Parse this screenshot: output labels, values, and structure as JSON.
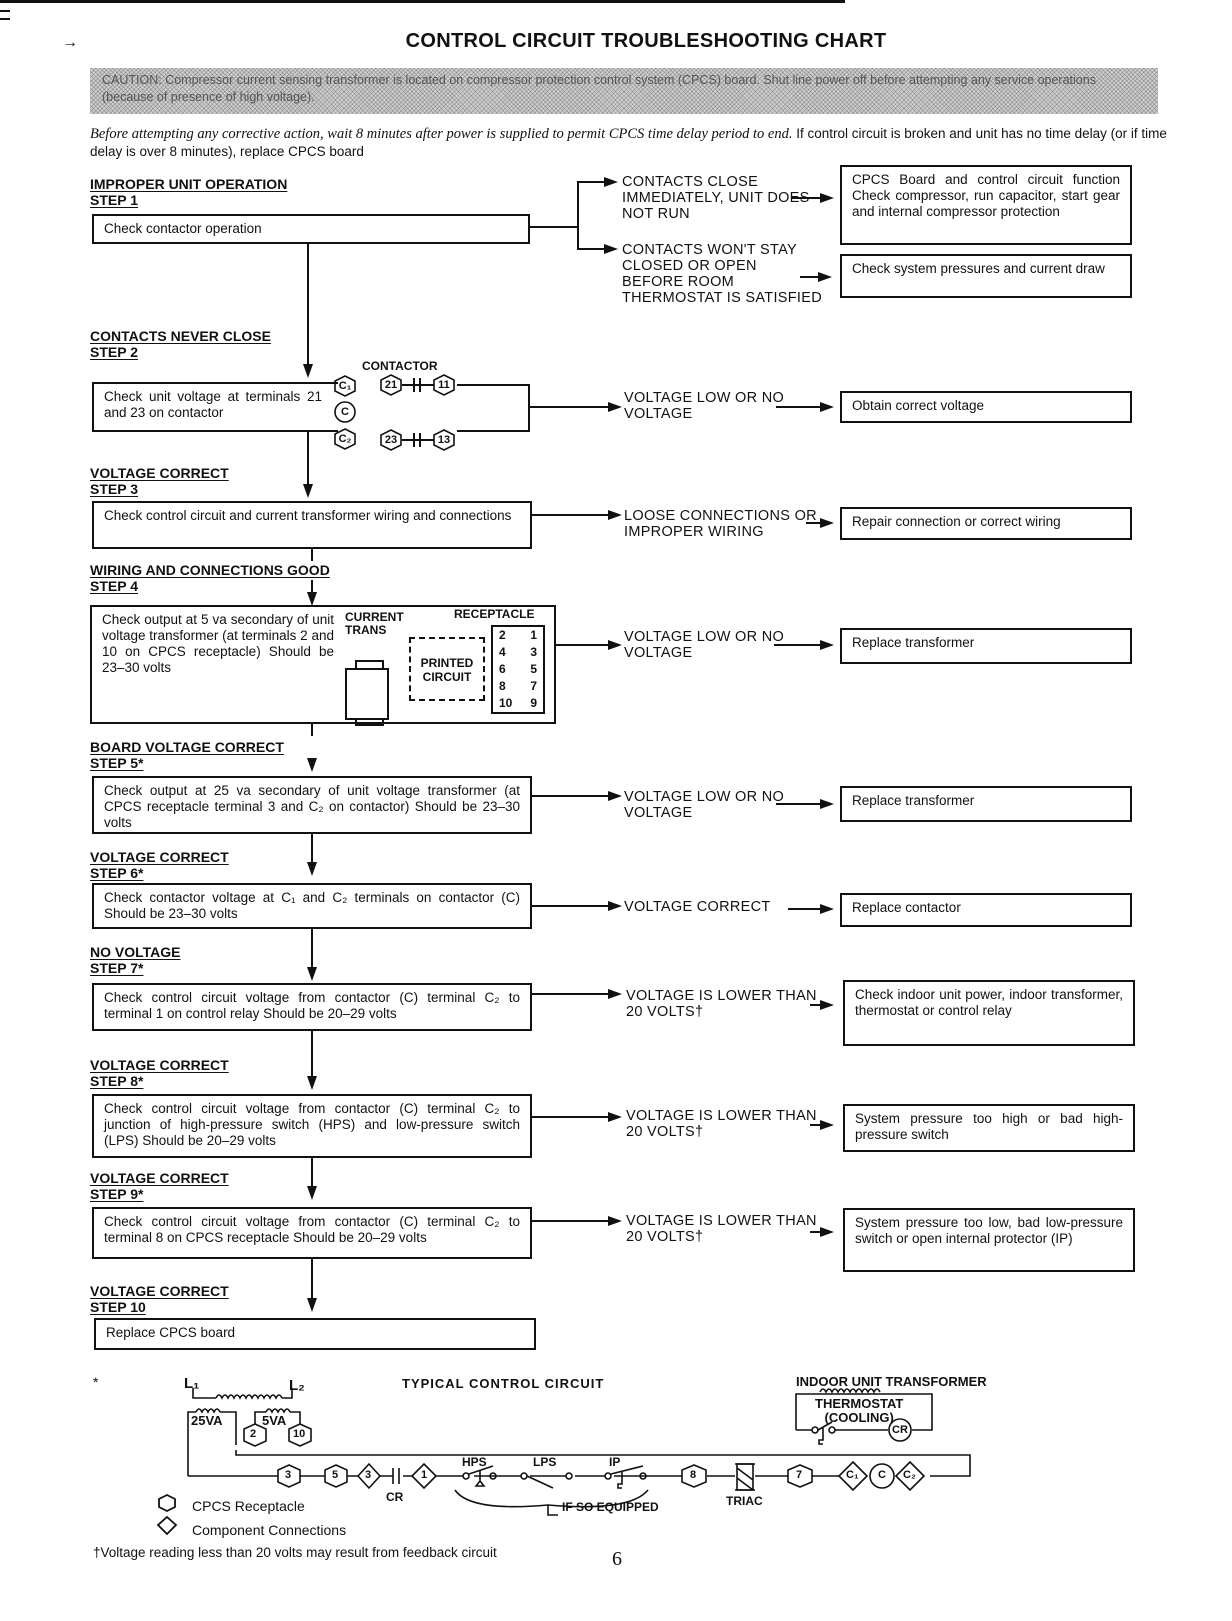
{
  "page": {
    "title": "CONTROL CIRCUIT TROUBLESHOOTING CHART",
    "caution": "CAUTION: Compressor current sensing transformer is located on compressor protection control system (CPCS) board. Shut line power off before attempting any service operations (because of presence of high voltage).",
    "intro_italic": "Before attempting any corrective action, wait 8 minutes after power is supplied to permit CPCS time delay period to end.",
    "intro_rest": " If control circuit is broken and unit has no time delay (or if time delay is over 8 minutes), replace CPCS board",
    "page_number": "6",
    "arrow_glyph": "→"
  },
  "steps": [
    {
      "heading": "IMPROPER UNIT OPERATION",
      "step": "STEP 1",
      "text": "Check contactor operation"
    },
    {
      "heading": "CONTACTS NEVER CLOSE",
      "step": "STEP 2",
      "text": "Check unit voltage at terminals 21 and 23 on contactor"
    },
    {
      "heading": "VOLTAGE CORRECT",
      "step": "STEP 3",
      "text": "Check control circuit and current transformer wiring and connections"
    },
    {
      "heading": "WIRING AND CONNECTIONS GOOD",
      "step": "STEP 4",
      "text": "Check output at 5 va secondary of unit voltage transformer (at terminals 2 and 10 on CPCS receptacle) Should be 23–30 volts"
    },
    {
      "heading": "BOARD VOLTAGE CORRECT",
      "step": "STEP 5*",
      "text": "Check output at 25 va secondary of unit voltage transformer (at CPCS receptacle terminal 3 and C₂ on contactor) Should be 23–30 volts"
    },
    {
      "heading": "VOLTAGE CORRECT",
      "step": "STEP 6*",
      "text": "Check contactor voltage at C₁ and C₂ terminals on contactor (C) Should be 23–30 volts"
    },
    {
      "heading": "NO VOLTAGE",
      "step": "STEP 7*",
      "text": "Check control circuit voltage from contactor (C) terminal C₂ to terminal 1 on control relay Should be 20–29 volts"
    },
    {
      "heading": "VOLTAGE CORRECT",
      "step": "STEP 8*",
      "text": "Check control circuit voltage from contactor (C) terminal C₂ to junction of high-pressure switch (HPS) and low-pressure switch (LPS) Should be 20–29 volts"
    },
    {
      "heading": "VOLTAGE CORRECT",
      "step": "STEP 9*",
      "text": "Check control circuit voltage from contactor (C) terminal C₂ to terminal 8 on CPCS receptacle Should be 20–29 volts"
    },
    {
      "heading": "VOLTAGE CORRECT",
      "step": "STEP 10",
      "text": "Replace CPCS board"
    }
  ],
  "branches": [
    {
      "condition": "CONTACTS CLOSE IMMEDIATELY, UNIT DOES NOT RUN",
      "action": "CPCS Board and control circuit function Check compressor, run capacitor, start gear and internal compressor protection"
    },
    {
      "condition": "CONTACTS WON'T STAY CLOSED OR OPEN BEFORE ROOM THERMOSTAT IS SATISFIED",
      "action": "Check system pressures and current draw"
    },
    {
      "condition": "VOLTAGE LOW OR NO VOLTAGE",
      "action": "Obtain correct voltage"
    },
    {
      "condition": "LOOSE CONNECTIONS OR IMPROPER WIRING",
      "action": "Repair connection or correct wiring"
    },
    {
      "condition": "VOLTAGE LOW OR NO VOLTAGE",
      "action": "Replace transformer"
    },
    {
      "condition": "VOLTAGE LOW OR NO VOLTAGE",
      "action": "Replace transformer"
    },
    {
      "condition": "VOLTAGE CORRECT",
      "action": "Replace contactor"
    },
    {
      "condition": "VOLTAGE IS LOWER THAN 20 VOLTS†",
      "action": "Check indoor unit power, indoor transformer, thermostat or control relay"
    },
    {
      "condition": "VOLTAGE IS LOWER THAN 20 VOLTS†",
      "action": "System pressure too high or bad high-pressure switch"
    },
    {
      "condition": "VOLTAGE IS LOWER THAN 20 VOLTS†",
      "action": "System pressure too low, bad low-pressure switch or open internal protector (IP)"
    }
  ],
  "contactor_diagram": {
    "label": "CONTACTOR",
    "terminals": {
      "c1": "C₁",
      "c": "C",
      "c2": "C₂",
      "t21": "21",
      "t11": "11",
      "t23": "23",
      "t13": "13"
    }
  },
  "step4_diagram": {
    "current_trans": "CURRENT TRANS",
    "receptacle": "RECEPTACLE",
    "printed_circuit_1": "PRINTED",
    "printed_circuit_2": "CIRCUIT",
    "receptacle_rows": [
      [
        "2",
        "1"
      ],
      [
        "4",
        "3"
      ],
      [
        "6",
        "5"
      ],
      [
        "8",
        "7"
      ],
      [
        "10",
        "9"
      ]
    ]
  },
  "circuit": {
    "star": "*",
    "title": "TYPICAL CONTROL CIRCUIT",
    "l1": "L₁",
    "l2": "L₂",
    "va25": "25VA",
    "va5": "5VA",
    "t2": "2",
    "t10": "10",
    "indoor_title": "INDOOR UNIT TRANSFORMER",
    "thermostat": "THERMOSTAT",
    "cooling": "(COOLING)",
    "cr_coil": "CR",
    "chain": {
      "t3a": "3",
      "t5": "5",
      "d3": "3",
      "cr": "CR",
      "d1": "1",
      "hps": "HPS",
      "lps": "LPS",
      "ip": "IP",
      "t8": "8",
      "triac": "TRIAC",
      "t7": "7",
      "dc1": "C₁",
      "cc": "C",
      "dc2": "C₂"
    },
    "if_equipped": "IF SO EQUIPPED"
  },
  "legend": {
    "hex_label": "CPCS Receptacle",
    "diamond_label": "Component Connections"
  },
  "footnote": "†Voltage reading less than 20 volts may result from feedback circuit"
}
